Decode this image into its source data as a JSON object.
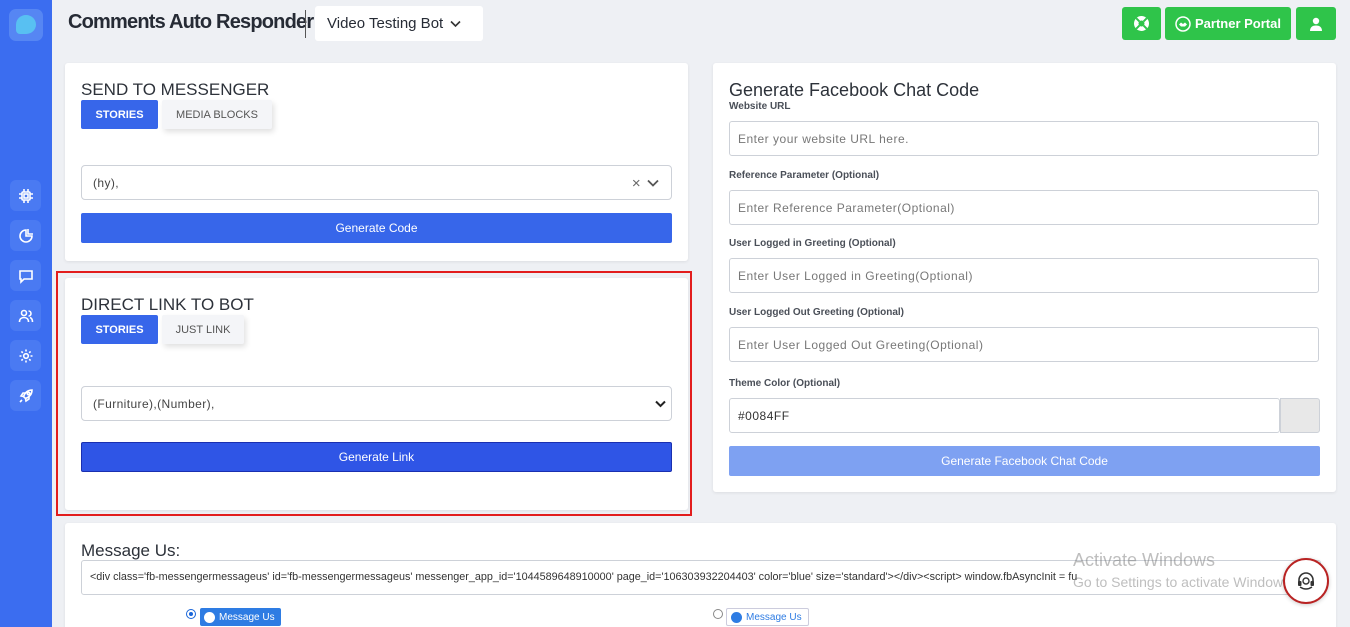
{
  "header": {
    "app_title": "Comments Auto Responder",
    "bot_select": "Video Testing Bot",
    "partner_portal": "Partner Portal"
  },
  "sidebar": {
    "icons": [
      "chip-icon",
      "pie-chart-icon",
      "chat-icon",
      "users-icon",
      "gear-icon",
      "rocket-icon"
    ]
  },
  "send_to_messenger": {
    "title": "SEND TO MESSENGER",
    "tabs": [
      "STORIES",
      "MEDIA BLOCKS"
    ],
    "select_value": "(hy),",
    "button": "Generate Code"
  },
  "direct_link": {
    "title": "DIRECT LINK TO BOT",
    "tabs": [
      "STORIES",
      "JUST LINK"
    ],
    "select_value": "(Furniture),(Number),",
    "button": "Generate Link"
  },
  "chat_code": {
    "title": "Generate Facebook Chat Code",
    "website_url_label": "Website URL",
    "website_url_placeholder": "Enter your website URL here.",
    "ref_label": "Reference Parameter (Optional)",
    "ref_placeholder": "Enter Reference Parameter(Optional)",
    "logged_in_label": "User Logged in Greeting (Optional)",
    "logged_in_placeholder": "Enter User Logged in Greeting(Optional)",
    "logged_out_label": "User Logged Out Greeting (Optional)",
    "logged_out_placeholder": "Enter User Logged Out Greeting(Optional)",
    "theme_label": "Theme Color (Optional)",
    "theme_value": "#0084FF",
    "button": "Generate Facebook Chat Code"
  },
  "message_us": {
    "title": "Message Us:",
    "code": "<div class='fb-messengermessageus' id='fb-messengermessageus' messenger_app_id='1044589648910000' page_id='106303932204403' color='blue' size='standard'></div><script> window.fbAsyncInit = fu",
    "option1": "Message Us",
    "option2": "Message Us"
  },
  "watermark": {
    "line1": "Activate Windows",
    "line2": "Go to Settings to activate Windows."
  },
  "colors": {
    "sidebar": "#3b6df0",
    "primary": "#3766ea",
    "green": "#2fc44a",
    "highlight": "#e21d1d"
  }
}
